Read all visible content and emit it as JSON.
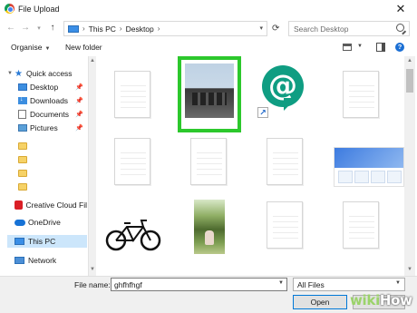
{
  "window": {
    "title": "File Upload",
    "close_glyph": "✕"
  },
  "nav": {
    "back_glyph": "←",
    "forward_glyph": "→",
    "recent_glyph": "▾",
    "up_glyph": "↑",
    "breadcrumbs": [
      "This PC",
      "Desktop"
    ],
    "separator": "›",
    "refresh_glyph": "⟳",
    "search_placeholder": "Search Desktop"
  },
  "toolbar": {
    "organise_label": "Organise",
    "new_folder_label": "New folder",
    "help_glyph": "?"
  },
  "sidebar": {
    "quick_access_label": "Quick access",
    "items": [
      {
        "label": "Desktop",
        "icon": "desktop-folder-icon",
        "pinned": true
      },
      {
        "label": "Downloads",
        "icon": "downloads-folder-icon",
        "pinned": true
      },
      {
        "label": "Documents",
        "icon": "documents-folder-icon",
        "pinned": true
      },
      {
        "label": "Pictures",
        "icon": "pictures-folder-icon",
        "pinned": true
      }
    ],
    "creative_cloud_label": "Creative Cloud Fil",
    "onedrive_label": "OneDrive",
    "this_pc_label": "This PC",
    "network_label": "Network"
  },
  "content": {
    "selected_item_border_color": "#2cc82c",
    "hangouts_color": "#0f9d82",
    "hangouts_glyph": "@",
    "shortcut_glyph": "↗"
  },
  "footer": {
    "file_name_label": "File name:",
    "file_name_value": "ghfhfhgf",
    "file_type_value": "All Files",
    "open_label": "Open",
    "cancel_label": ""
  },
  "watermark": {
    "wiki": "wiki",
    "how": "How"
  }
}
